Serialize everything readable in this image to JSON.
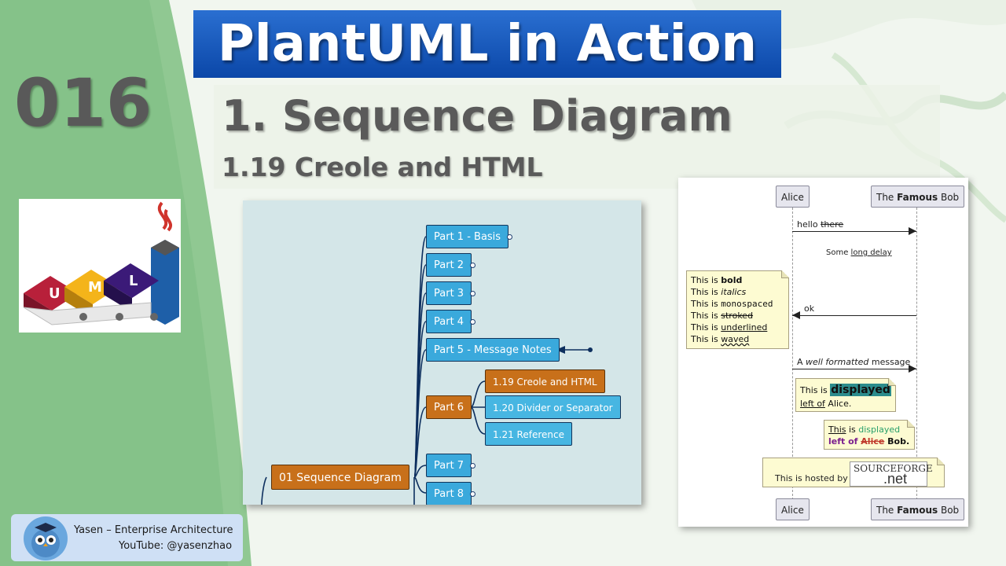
{
  "banner": {
    "title": "PlantUML in Action"
  },
  "episode": {
    "number": "016"
  },
  "section": {
    "title": "1. Sequence Diagram",
    "topic": "1.19 Creole and HTML"
  },
  "logo": {
    "letters": [
      "U",
      "M",
      "L"
    ]
  },
  "footer": {
    "name": "Yasen – Enterprise Architecture",
    "youtube": "YouTube: @yasenzhao"
  },
  "mindmap": {
    "root": "01 Sequence Diagram",
    "parts": [
      "Part 1 - Basis",
      "Part 2",
      "Part 3",
      "Part 4",
      "Part 5 - Message Notes",
      "Part 6",
      "Part 7",
      "Part 8"
    ],
    "part6_children": [
      "1.19 Creole and HTML",
      "1.20 Divider or Separator",
      "1.21 Reference"
    ]
  },
  "sequence": {
    "actor_alice": "Alice",
    "actor_bob_prefix": "The ",
    "actor_bob_bold": "Famous",
    "actor_bob_suffix": " Bob",
    "msg1_a": "hello ",
    "msg1_b": "there",
    "delay_a": "Some ",
    "delay_b": "long delay",
    "msg2": "ok",
    "msg3_a": "A ",
    "msg3_b": "well formatted",
    "msg3_c": " message",
    "note1": [
      {
        "pre": "This is ",
        "word": "bold"
      },
      {
        "pre": "This is ",
        "word": "italics"
      },
      {
        "pre": "This is ",
        "word": "monospaced"
      },
      {
        "pre": "This is ",
        "word": "stroked"
      },
      {
        "pre": "This is ",
        "word": "underlined"
      },
      {
        "pre": "This is ",
        "word": "waved"
      }
    ],
    "note2": {
      "a": "This is ",
      "b": "displayed",
      "c": "left of",
      "d": " Alice."
    },
    "note3": {
      "a": "This",
      "b": " is ",
      "c": "displayed",
      "d": "left of ",
      "e": "Alice",
      "f": " Bob."
    },
    "note4": {
      "text": "This is hosted by",
      "brand_a": "SOURCEFORGE",
      "brand_b": ".net"
    },
    "colors": {
      "note_bg": "#fdfbd2",
      "highlight": "#2c8c8c",
      "green": "#29a06b",
      "purple": "#7a1f8f",
      "strike": "#c0392b"
    }
  }
}
